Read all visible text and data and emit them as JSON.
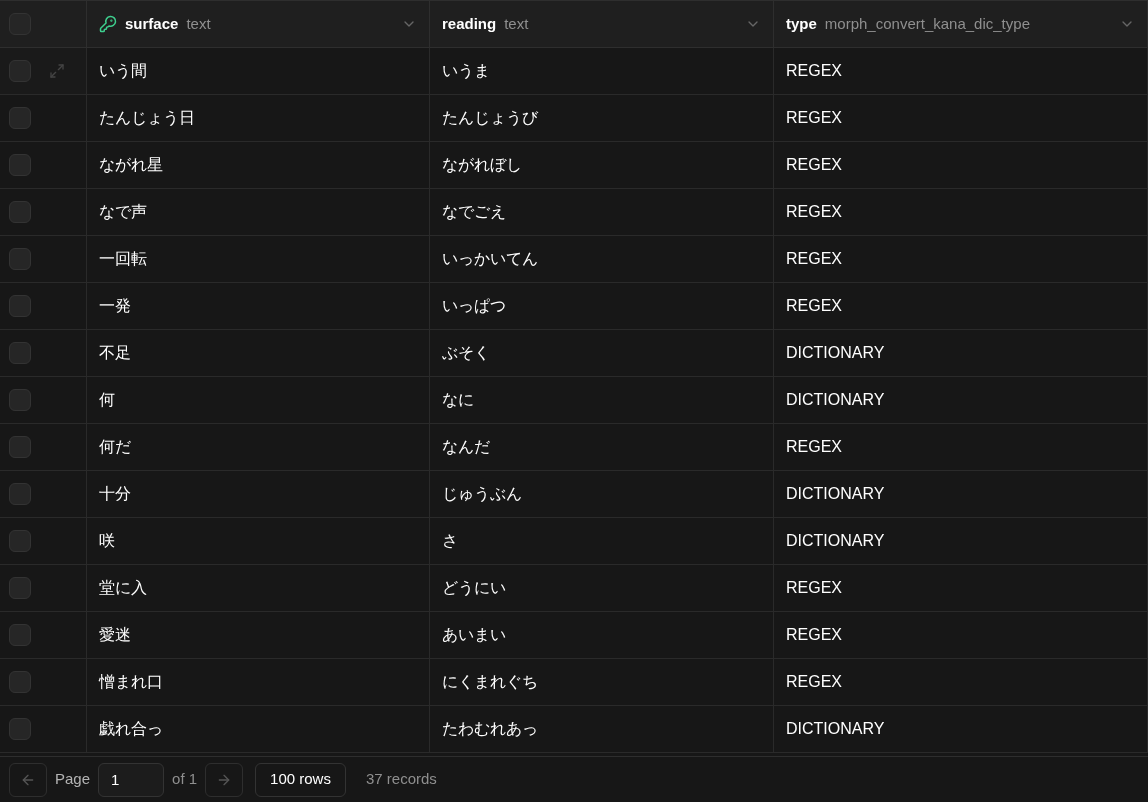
{
  "all_checked": false,
  "columns": [
    {
      "name": "surface",
      "type": "text",
      "primary_key": true
    },
    {
      "name": "reading",
      "type": "text",
      "primary_key": false
    },
    {
      "name": "type",
      "type": "morph_convert_kana_dic_type",
      "primary_key": false
    }
  ],
  "rows": [
    {
      "cells": [
        "いう間",
        "いうま",
        "REGEX"
      ],
      "checked": false,
      "hovered": true
    },
    {
      "cells": [
        "たんじょう日",
        "たんじょうび",
        "REGEX"
      ],
      "checked": false,
      "hovered": false
    },
    {
      "cells": [
        "ながれ星",
        "ながれぼし",
        "REGEX"
      ],
      "checked": false,
      "hovered": false
    },
    {
      "cells": [
        "なで声",
        "なでごえ",
        "REGEX"
      ],
      "checked": false,
      "hovered": false
    },
    {
      "cells": [
        "一回転",
        "いっかいてん",
        "REGEX"
      ],
      "checked": false,
      "hovered": false
    },
    {
      "cells": [
        "一発",
        "いっぱつ",
        "REGEX"
      ],
      "checked": false,
      "hovered": false
    },
    {
      "cells": [
        "不足",
        "ぶそく",
        "DICTIONARY"
      ],
      "checked": false,
      "hovered": false
    },
    {
      "cells": [
        "何",
        "なに",
        "DICTIONARY"
      ],
      "checked": false,
      "hovered": false
    },
    {
      "cells": [
        "何だ",
        "なんだ",
        "REGEX"
      ],
      "checked": false,
      "hovered": false
    },
    {
      "cells": [
        "十分",
        "じゅうぶん",
        "DICTIONARY"
      ],
      "checked": false,
      "hovered": false
    },
    {
      "cells": [
        "咲",
        "さ",
        "DICTIONARY"
      ],
      "checked": false,
      "hovered": false
    },
    {
      "cells": [
        "堂に入",
        "どうにい",
        "REGEX"
      ],
      "checked": false,
      "hovered": false
    },
    {
      "cells": [
        "愛迷",
        "あいまい",
        "REGEX"
      ],
      "checked": false,
      "hovered": false
    },
    {
      "cells": [
        "憎まれ口",
        "にくまれぐち",
        "REGEX"
      ],
      "checked": false,
      "hovered": false
    },
    {
      "cells": [
        "戯れ合っ",
        "たわむれあっ",
        "DICTIONARY"
      ],
      "checked": false,
      "hovered": false
    }
  ],
  "footer": {
    "prev_disabled": true,
    "page_label": "Page",
    "page_value": "1",
    "of_label": "of 1",
    "next_disabled": true,
    "rows_button": "100 rows",
    "records": "37 records"
  }
}
